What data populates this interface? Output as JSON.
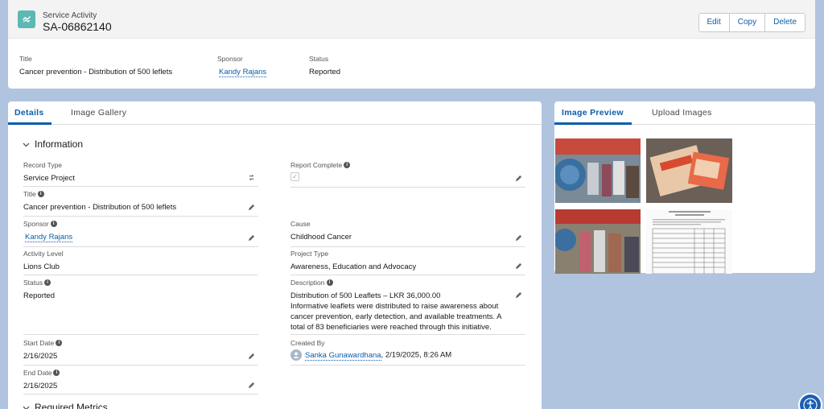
{
  "header": {
    "object_type": "Service Activity",
    "record_name": "SA-06862140",
    "actions": [
      "Edit",
      "Copy",
      "Delete"
    ]
  },
  "highlights": {
    "title_label": "Title",
    "title_value": "Cancer prevention - Distribution of 500 leflets",
    "sponsor_label": "Sponsor",
    "sponsor_value": "Kandy Rajans",
    "status_label": "Status",
    "status_value": "Reported"
  },
  "left_tabs": [
    "Details",
    "Image Gallery"
  ],
  "right_tabs": [
    "Image Preview",
    "Upload Images"
  ],
  "section": "Information",
  "next_section": "Required Metrics",
  "fields": {
    "record_type": {
      "label": "Record Type",
      "value": "Service Project"
    },
    "title": {
      "label": "Title",
      "value": "Cancer prevention - Distribution of 500 leflets"
    },
    "sponsor": {
      "label": "Sponsor",
      "value": "Kandy Rajans"
    },
    "activity_level": {
      "label": "Activity Level",
      "value": "Lions Club"
    },
    "status": {
      "label": "Status",
      "value": "Reported"
    },
    "start_date": {
      "label": "Start Date",
      "value": "2/16/2025"
    },
    "end_date": {
      "label": "End Date",
      "value": "2/16/2025"
    },
    "report_complete": {
      "label": "Report Complete",
      "value": "✓"
    },
    "cause": {
      "label": "Cause",
      "value": "Childhood Cancer"
    },
    "project_type": {
      "label": "Project Type",
      "value": "Awareness, Education and Advocacy"
    },
    "description": {
      "label": "Description",
      "value": "Distribution of 500 Leaflets – LKR 36,000.00\nInformative leaflets were distributed to raise awareness about cancer prevention, early detection, and available treatments. A total of 83 beneficiaries were reached through this initiative."
    },
    "created_by": {
      "label": "Created By",
      "user": "Sanka Gunawardhana",
      "date": ", 2/19/2025, 8:26 AM"
    }
  },
  "colors": {
    "accent": "#0b5cab",
    "icon_bg": "#5cb8b2",
    "background": "#b0c4df"
  }
}
